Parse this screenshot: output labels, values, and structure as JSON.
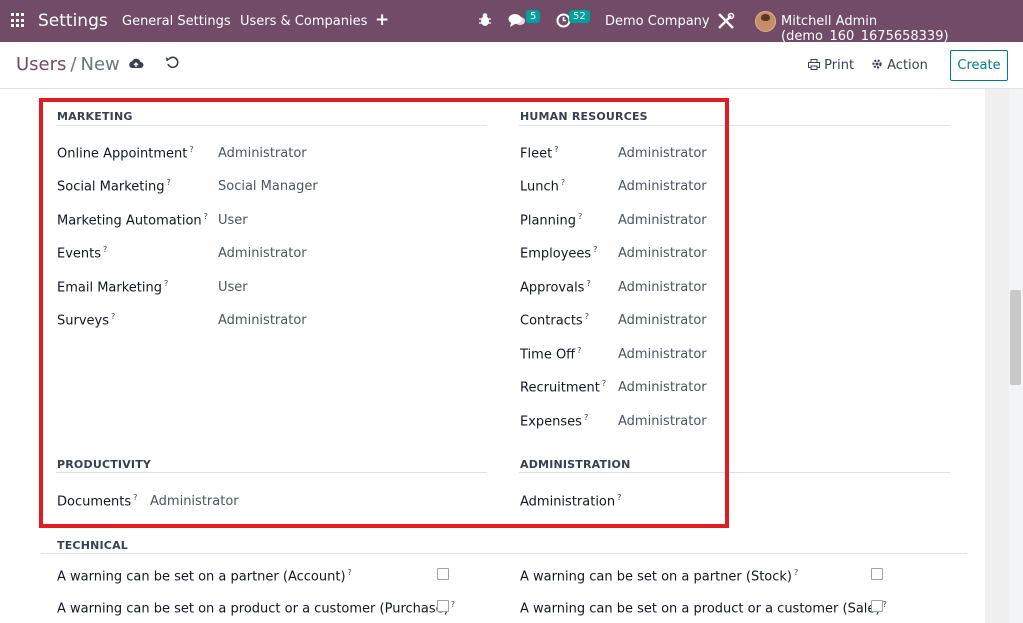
{
  "navbar": {
    "app_title": "Settings",
    "menu": [
      "General Settings",
      "Users & Companies"
    ],
    "add_label": "+",
    "chat_count": "5",
    "activity_count": "52",
    "company": "Demo Company",
    "user": "Mitchell Admin (demo_160_1675658339)"
  },
  "control_panel": {
    "breadcrumb_parent": "Users",
    "breadcrumb_sep": "/",
    "breadcrumb_current": "New",
    "print_label": "Print",
    "action_label": "Action",
    "create_label": "Create"
  },
  "groups": {
    "marketing": {
      "title": "MARKETING",
      "fields": [
        {
          "label": "Online Appointment",
          "value": "Administrator"
        },
        {
          "label": "Social Marketing",
          "value": "Social Manager"
        },
        {
          "label": "Marketing Automation",
          "value": "User"
        },
        {
          "label": "Events",
          "value": "Administrator"
        },
        {
          "label": "Email Marketing",
          "value": "User"
        },
        {
          "label": "Surveys",
          "value": "Administrator"
        }
      ]
    },
    "human_resources": {
      "title": "HUMAN RESOURCES",
      "fields": [
        {
          "label": "Fleet",
          "value": "Administrator"
        },
        {
          "label": "Lunch",
          "value": "Administrator"
        },
        {
          "label": "Planning",
          "value": "Administrator"
        },
        {
          "label": "Employees",
          "value": "Administrator"
        },
        {
          "label": "Approvals",
          "value": "Administrator"
        },
        {
          "label": "Contracts",
          "value": "Administrator"
        },
        {
          "label": "Time Off",
          "value": "Administrator"
        },
        {
          "label": "Recruitment",
          "value": "Administrator"
        },
        {
          "label": "Expenses",
          "value": "Administrator"
        }
      ]
    },
    "productivity": {
      "title": "PRODUCTIVITY",
      "fields": [
        {
          "label": "Documents",
          "value": "Administrator"
        }
      ]
    },
    "administration": {
      "title": "ADMINISTRATION",
      "fields": [
        {
          "label": "Administration",
          "value": ""
        }
      ]
    },
    "technical": {
      "title": "TECHNICAL",
      "fields": [
        {
          "label": "A warning can be set on a partner (Account)",
          "checked": false
        },
        {
          "label": "A warning can be set on a partner (Stock)",
          "checked": false
        },
        {
          "label": "A warning can be set on a product or a customer (Purchase)",
          "checked": false
        },
        {
          "label": "A warning can be set on a product or a customer (Sale)",
          "checked": false
        }
      ]
    }
  },
  "help_marker": "?",
  "colors": {
    "navbar": "#714b67",
    "accent": "#017e84",
    "highlight": "#e31b23"
  }
}
